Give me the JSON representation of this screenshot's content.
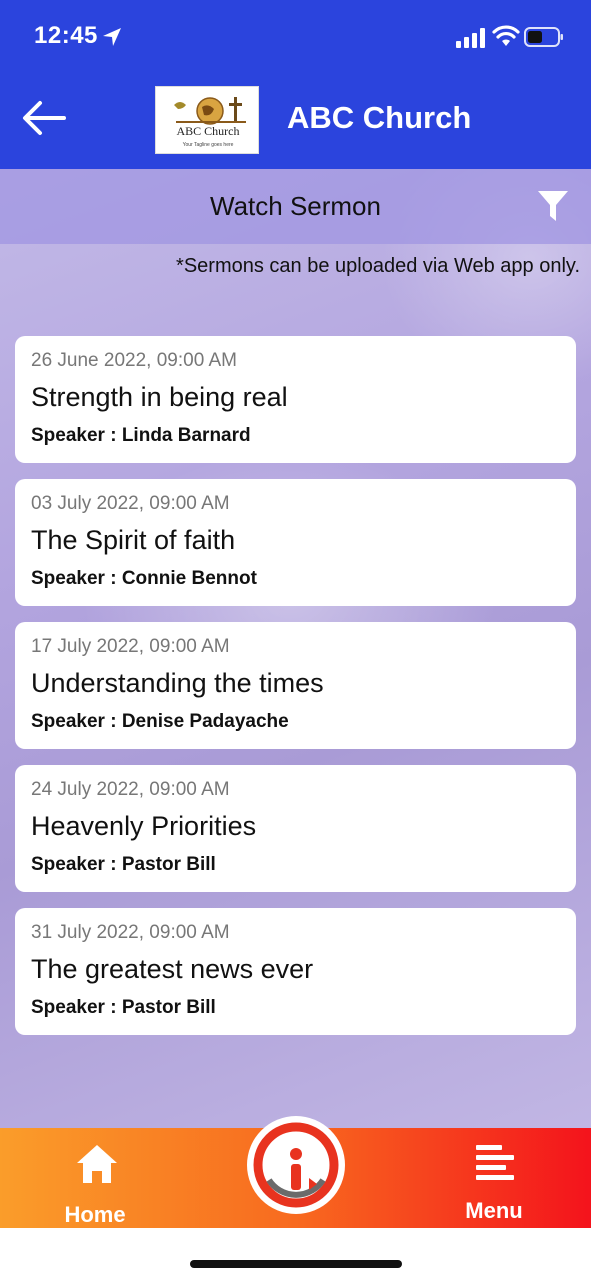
{
  "status_bar": {
    "time": "12:45"
  },
  "header": {
    "title": "ABC Church",
    "logo": {
      "name": "ABC Church",
      "tagline": "Your Tagline goes here"
    }
  },
  "page": {
    "title": "Watch Sermon",
    "notice": "*Sermons can be uploaded via Web app only."
  },
  "sermons": [
    {
      "date": "26 June 2022, 09:00 AM",
      "title": "Strength in being real",
      "speaker": "Speaker : Linda Barnard"
    },
    {
      "date": "03 July 2022, 09:00 AM",
      "title": "The Spirit of faith",
      "speaker": "Speaker : Connie Bennot"
    },
    {
      "date": "17 July 2022, 09:00 AM",
      "title": "Understanding the times",
      "speaker": "Speaker : Denise Padayache"
    },
    {
      "date": "24 July 2022, 09:00 AM",
      "title": "Heavenly Priorities",
      "speaker": "Speaker : Pastor Bill"
    },
    {
      "date": "31 July 2022, 09:00 AM",
      "title": "The greatest news ever",
      "speaker": "Speaker : Pastor Bill"
    }
  ],
  "nav": {
    "home_label": "Home",
    "menu_label": "Menu"
  },
  "colors": {
    "header": "#2b44dd",
    "nav_start": "#fa9d2a",
    "nav_end": "#f4131c"
  },
  "icons": [
    "location-arrow-icon",
    "signal-icon",
    "wifi-icon",
    "battery-icon",
    "back-arrow-icon",
    "filter-icon",
    "home-icon",
    "app-logo-icon",
    "menu-icon"
  ]
}
